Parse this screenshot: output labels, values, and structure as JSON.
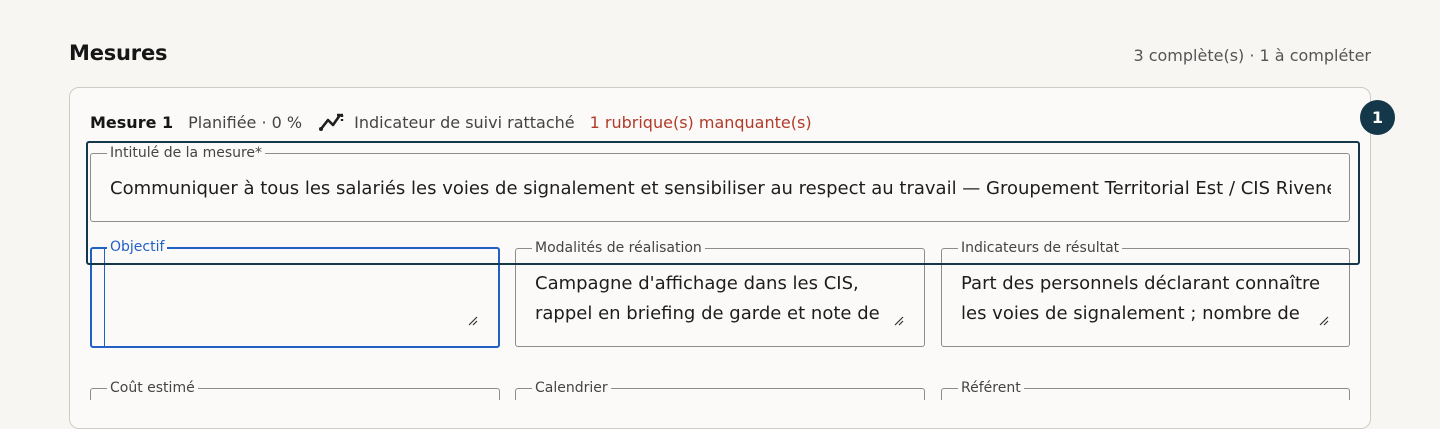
{
  "section": {
    "title": "Mesures",
    "status": "3 complète(s) · 1 à compléter"
  },
  "measure": {
    "name": "Mesure 1",
    "state": "Planifiée · 0 %",
    "indicator_label": "Indicateur de suivi rattaché",
    "missing_label": "1 rubrique(s) manquante(s)",
    "badge": "1",
    "fields": {
      "intitule": {
        "label": "Intitulé de la mesure*",
        "value": "Communiquer à tous les salariés les voies de signalement et sensibiliser au respect au travail — Groupement Territorial Est / CIS Riveneu"
      },
      "objectif": {
        "label": "Objectif",
        "value": ""
      },
      "modalites": {
        "label": "Modalités de réalisation",
        "value": "Campagne d'affichage dans les CIS, rappel en briefing de garde et note de"
      },
      "indicateurs": {
        "label": "Indicateurs de résultat",
        "value": "Part des personnels déclarant connaître les voies de signalement ; nombre de"
      },
      "cout": {
        "label": "Coût estimé"
      },
      "calendrier": {
        "label": "Calendrier"
      },
      "referent": {
        "label": "Référent"
      }
    }
  },
  "icons": {
    "indicator": "trend-chart-icon",
    "resize": "resize-handle-icon"
  },
  "colors": {
    "focus": "#2160c4",
    "highlight": "#14384a",
    "missing": "#b23a2a"
  }
}
